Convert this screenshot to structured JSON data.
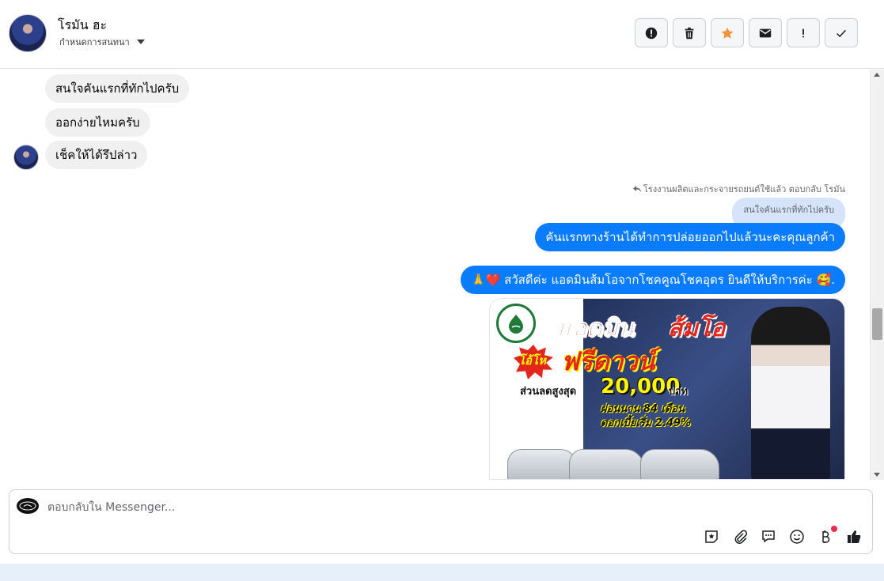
{
  "header": {
    "contact_name": "โรมัน ฮะ",
    "subtitle": "กำหนดการสนทนา",
    "actions": [
      {
        "name": "spam-button",
        "icon": "alert-circle-icon"
      },
      {
        "name": "delete-button",
        "icon": "trash-icon"
      },
      {
        "name": "star-button",
        "icon": "star-icon"
      },
      {
        "name": "mark-unread-button",
        "icon": "envelope-icon"
      },
      {
        "name": "priority-button",
        "icon": "exclamation-icon"
      },
      {
        "name": "done-button",
        "icon": "check-icon"
      }
    ]
  },
  "messages": {
    "incoming": [
      "สนใจคันแรกที่ทักไปครับ",
      "ออกง่ายไหมครับ",
      "เช็คให้ได้รึปล่าว"
    ],
    "reply_note": "โรงงานผลิตและกระจายรถยนต์ใช้แล้ว ตอบกลับ โรมัน",
    "quoted_text": "สนใจคันแรกที่ทักไปครับ",
    "outgoing_reply": "คันแรกทางร้านได้ทำการปล่อยออกไปแล้วนะคะคุณลูกค้า",
    "outgoing_greeting": "🙏❤️ สวัสดีค่ะ แอดมินส้มโอจากโชคคูณโชคอุดร ยินดีให้บริการค่ะ 🥰.",
    "ad": {
      "title_left": "แอดมิน",
      "title_right": "ส้มโอ",
      "free_small": "โอ้โห",
      "free_big": "ฟรีดาวน์",
      "discount_label": "ส่วนลดสูงสุด",
      "discount_amount": "20,000",
      "discount_unit": "บาท",
      "term": "ผ่อนนาน 84 เดือน",
      "rate": "ดอกเบี้ยเริ่ม 2.49%"
    }
  },
  "composer": {
    "placeholder": "ตอบกลับใน Messenger...",
    "tools": [
      "sticker-icon",
      "attachment-icon",
      "saved-reply-icon",
      "emoji-icon",
      "payment-icon",
      "like-icon"
    ]
  },
  "colors": {
    "outgoing_bubble": "#0a7cff",
    "incoming_bubble": "#f0f0f0",
    "quoted_bubble": "#d6e4fb",
    "star": "#f7923a"
  }
}
